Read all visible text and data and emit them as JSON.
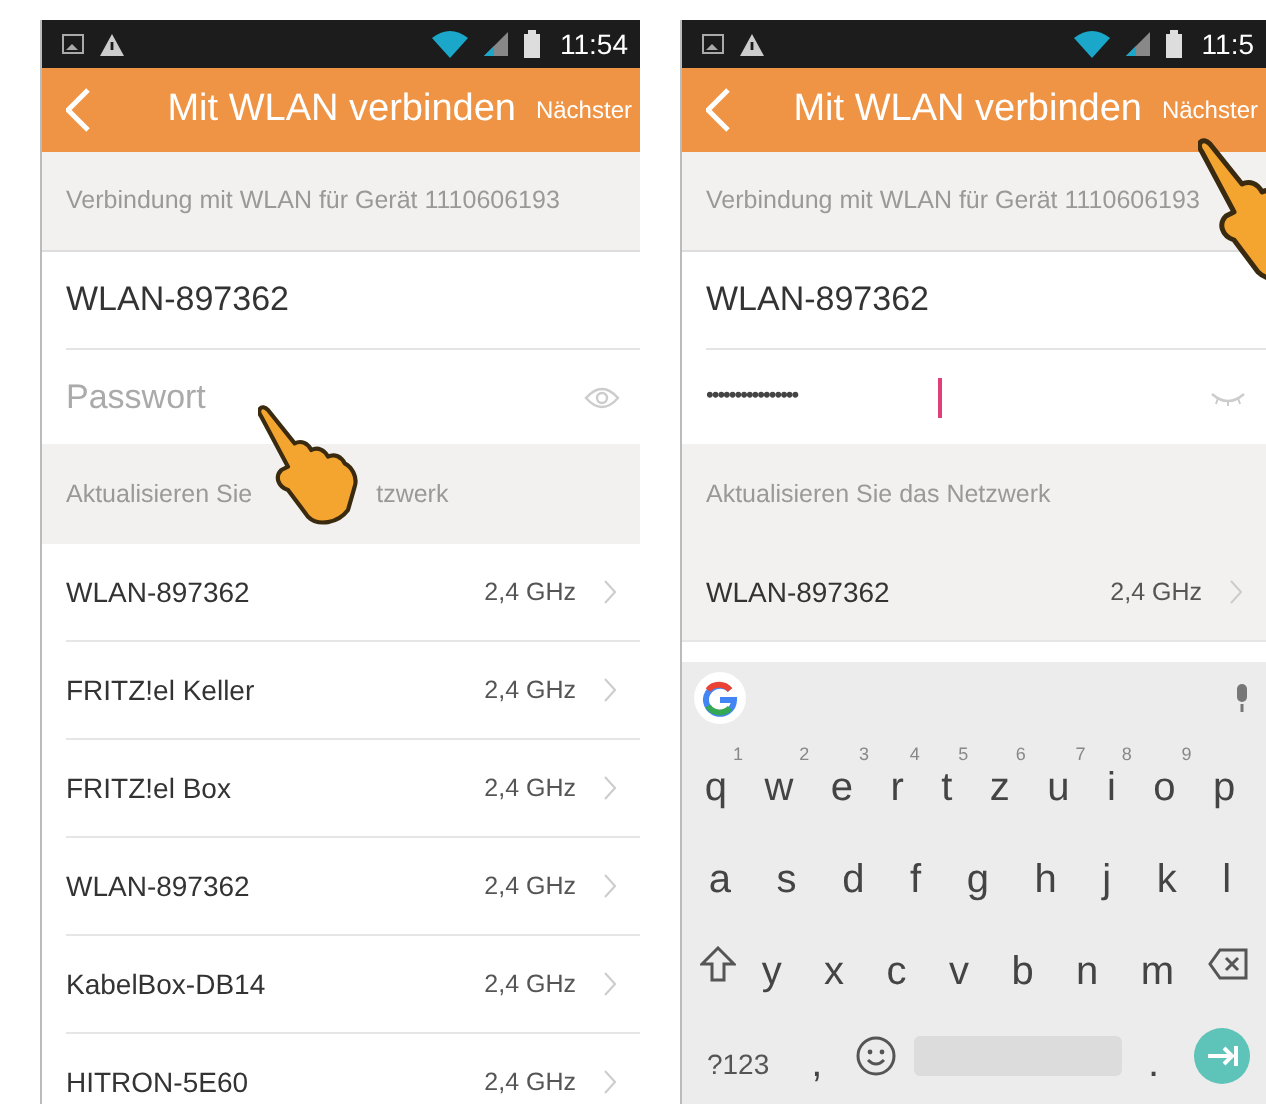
{
  "screens": [
    {
      "status_bar": {
        "time": "11:54"
      },
      "header": {
        "title": "Mit WLAN verbinden",
        "action": "Nächster"
      },
      "device_info": "Verbindung mit WLAN für Gerät 1110606193",
      "ssid": "WLAN-897362",
      "password": {
        "placeholder": "Passwort",
        "eye_open": true
      },
      "section_label": [
        "Aktualisieren Sie",
        "tzwerk"
      ],
      "networks": [
        {
          "name": "WLAN-897362",
          "band": "2,4 GHz"
        },
        {
          "name": "FRITZ!el Keller",
          "band": "2,4 GHz"
        },
        {
          "name": "FRITZ!el Box",
          "band": "2,4 GHz"
        },
        {
          "name": "WLAN-897362",
          "band": "2,4 GHz"
        },
        {
          "name": "KabelBox-DB14",
          "band": "2,4 GHz"
        },
        {
          "name": "HITRON-5E60",
          "band": "2,4 GHz"
        }
      ],
      "pointer": {
        "kind": "password"
      }
    },
    {
      "status_bar": {
        "time": "11:5"
      },
      "header": {
        "title": "Mit WLAN verbinden",
        "action": "Nächster"
      },
      "device_info": "Verbindung mit WLAN für Gerät 1110606193",
      "ssid": "WLAN-897362",
      "password": {
        "value": "••••••••••••••••",
        "eye_open": false
      },
      "section_label": [
        "Aktualisieren Sie das Netzwerk"
      ],
      "networks": [
        {
          "name": "WLAN-897362",
          "band": "2,4 GHz"
        }
      ],
      "pointer": {
        "kind": "next"
      },
      "keyboard": {
        "rows": [
          {
            "keys": [
              {
                "kind": "char",
                "label": "q",
                "hint": "1"
              },
              {
                "kind": "char",
                "label": "w",
                "hint": "2"
              },
              {
                "kind": "char",
                "label": "e",
                "hint": "3"
              },
              {
                "kind": "char",
                "label": "r",
                "hint": "4"
              },
              {
                "kind": "char",
                "label": "t",
                "hint": "5"
              },
              {
                "kind": "char",
                "label": "z",
                "hint": "6"
              },
              {
                "kind": "char",
                "label": "u",
                "hint": "7"
              },
              {
                "kind": "char",
                "label": "i",
                "hint": "8"
              },
              {
                "kind": "char",
                "label": "o",
                "hint": "9"
              },
              {
                "kind": "char",
                "label": "p"
              }
            ]
          },
          {
            "keys": [
              {
                "kind": "char",
                "label": "a"
              },
              {
                "kind": "char",
                "label": "s"
              },
              {
                "kind": "char",
                "label": "d"
              },
              {
                "kind": "char",
                "label": "f"
              },
              {
                "kind": "char",
                "label": "g"
              },
              {
                "kind": "char",
                "label": "h"
              },
              {
                "kind": "char",
                "label": "j"
              },
              {
                "kind": "char",
                "label": "k"
              },
              {
                "kind": "char",
                "label": "l"
              }
            ]
          },
          {
            "keys": [
              {
                "kind": "shift"
              },
              {
                "kind": "char",
                "label": "y"
              },
              {
                "kind": "char",
                "label": "x"
              },
              {
                "kind": "char",
                "label": "c"
              },
              {
                "kind": "char",
                "label": "v"
              },
              {
                "kind": "char",
                "label": "b"
              },
              {
                "kind": "char",
                "label": "n"
              },
              {
                "kind": "char",
                "label": "m"
              },
              {
                "kind": "backspace"
              }
            ]
          },
          {
            "keys": [
              {
                "kind": "text",
                "label": "?123"
              },
              {
                "kind": "char",
                "label": ","
              },
              {
                "kind": "emoji"
              },
              {
                "kind": "space"
              },
              {
                "kind": "char",
                "label": "."
              },
              {
                "kind": "enter"
              }
            ]
          }
        ]
      }
    }
  ]
}
